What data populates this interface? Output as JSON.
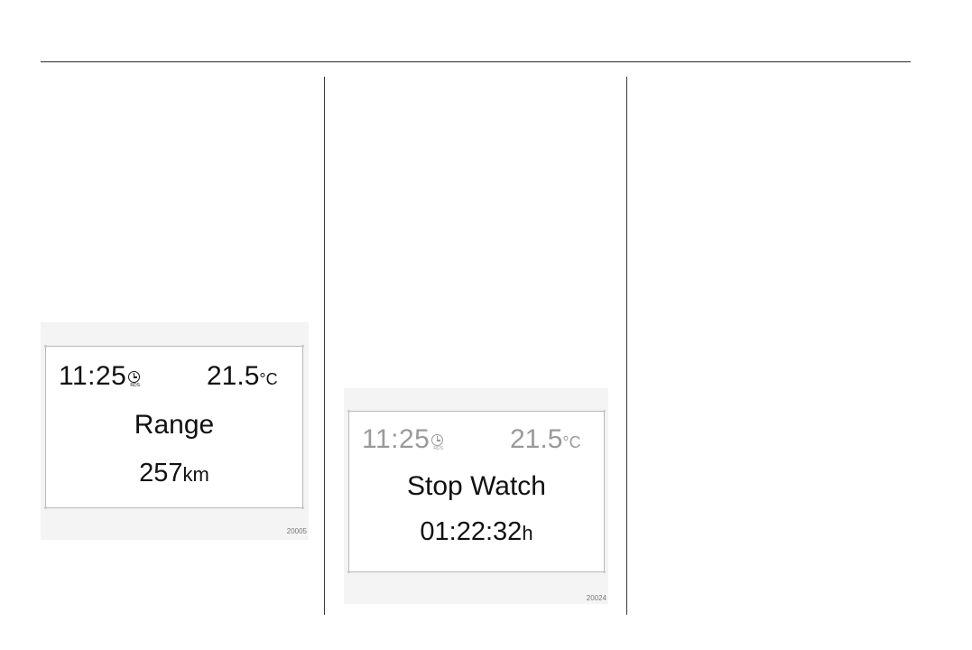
{
  "figures": [
    {
      "time": "11:25",
      "rds_label": "RDS",
      "temperature": "21.5",
      "temperature_unit": "°C",
      "title": "Range",
      "value": "257",
      "value_unit": "km",
      "figure_code": "20005"
    },
    {
      "time": "11:25",
      "rds_label": "RDS",
      "temperature": "21.5",
      "temperature_unit": "°C",
      "title": "Stop Watch",
      "value": "01:22:32",
      "value_unit": "h",
      "figure_code": "20024"
    }
  ],
  "icons": {
    "clock": "clock-icon"
  },
  "colors": {
    "rule": "#2a2a2a",
    "figure_bg": "#f4f4f4",
    "dim_text": "#9a9a9a"
  }
}
